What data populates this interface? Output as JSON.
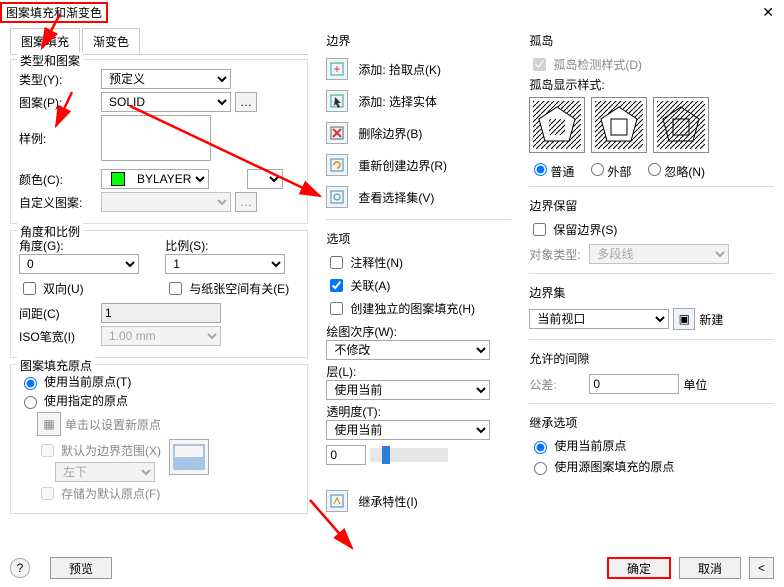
{
  "window": {
    "title": "图案填充和渐变色",
    "close": "✕"
  },
  "tabs": {
    "hatch": "图案填充",
    "gradient": "渐变色"
  },
  "typeGroup": {
    "title": "类型和图案",
    "type_label": "类型(Y):",
    "type_value": "预定义",
    "pattern_label": "图案(P):",
    "pattern_value": "SOLID",
    "sample_label": "样例:",
    "color_label": "颜色(C):",
    "color_value": "BYLAYER",
    "custom_label": "自定义图案:"
  },
  "angleGroup": {
    "title": "角度和比例",
    "angle_label": "角度(G):",
    "angle_value": "0",
    "scale_label": "比例(S):",
    "scale_value": "1",
    "bidir": "双向(U)",
    "paper": "与纸张空间有关(E)",
    "gap_label": "间距(C)",
    "gap_value": "1",
    "iso_label": "ISO笔宽(I)",
    "iso_value": "1.00 mm"
  },
  "originGroup": {
    "title": "图案填充原点",
    "use_current": "使用当前原点(T)",
    "use_spec": "使用指定的原点",
    "click_set": "单击以设置新原点",
    "default_bound": "默认为边界范围(X)",
    "pos_value": "左下",
    "store": "存储为默认原点(F)"
  },
  "boundary": {
    "title": "边界",
    "add_pick": "添加: 拾取点(K)",
    "add_sel": "添加: 选择实体",
    "del": "删除边界(B)",
    "recreate": "重新创建边界(R)",
    "viewsel": "查看选择集(V)"
  },
  "options": {
    "title": "选项",
    "annot": "注释性(N)",
    "assoc": "关联(A)",
    "indep": "创建独立的图案填充(H)",
    "draworder_label": "绘图次序(W):",
    "draworder_value": "不修改",
    "layer_label": "层(L):",
    "layer_value": "使用当前",
    "trans_label": "透明度(T):",
    "trans_value": "使用当前",
    "trans_num": "0",
    "inherit": "继承特性(I)"
  },
  "island": {
    "title": "孤岛",
    "detect": "孤岛检测样式(D)",
    "disp": "孤岛显示样式:",
    "normal": "普通",
    "outer": "外部",
    "ignore": "忽略(N)"
  },
  "retain": {
    "title": "边界保留",
    "keep": "保留边界(S)",
    "objtype_label": "对象类型:",
    "objtype_value": "多段线"
  },
  "bset": {
    "title": "边界集",
    "value": "当前视口",
    "new": "新建"
  },
  "gap": {
    "title": "允许的间隙",
    "tol_label": "公差:",
    "tol_value": "0",
    "unit": "单位"
  },
  "inheritOpt": {
    "title": "继承选项",
    "cur": "使用当前原点",
    "src": "使用源图案填充的原点"
  },
  "footer": {
    "preview": "预览",
    "ok": "确定",
    "cancel": "取消"
  }
}
